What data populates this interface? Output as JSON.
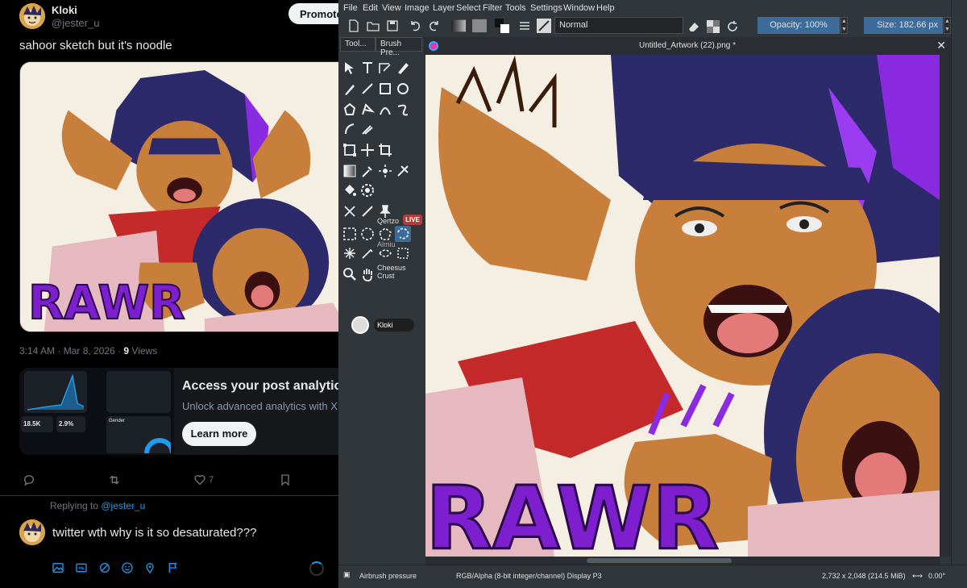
{
  "twitter": {
    "author": {
      "name": "Kloki",
      "handle": "@jester_u"
    },
    "promote_label": "Promote",
    "post_text": "sahoor sketch but it's noodle",
    "meta": {
      "time": "3:14 AM · Mar 8, 2026 · ",
      "views_count": "9",
      "views_label": " Views"
    },
    "analytics": {
      "title": "Access your post analytics",
      "subtitle": "Unlock advanced analytics with X P",
      "cta": "Learn more",
      "thumb_stats": [
        "18.5K",
        "2.9%"
      ],
      "thumb_label": "Gender"
    },
    "actions": {
      "likes": "7"
    },
    "reply": {
      "replying_prefix": "Replying to ",
      "replying_to": "@jester_u",
      "text": "twitter wth why is it so desaturated???"
    },
    "artwork_text": "RAWR"
  },
  "krita": {
    "menus": [
      "File",
      "Edit",
      "View",
      "Image",
      "Layer",
      "Select",
      "Filter",
      "Tools",
      "Settings",
      "Window",
      "Help"
    ],
    "blend_mode": "Normal",
    "opacity": "Opacity: 100%",
    "size": "Size: 182.66 px",
    "dock_tabs": [
      "Tool...",
      "Brush Pre..."
    ],
    "document_title": "Untitled_Artwork (22).png *",
    "collaborators": [
      "Qertzo",
      "Almiu",
      "Cheesus Crust",
      "Kloki"
    ],
    "live_badge": "LIVE",
    "status": {
      "brush": "Airbrush pressure",
      "color_info": "RGB/Alpha (8-bit integer/channel)  Display P3",
      "dimensions": "2,732 x 2,048 (214.5 MiB)",
      "rotation": "0.00°"
    },
    "accent_color": "#3d6c9a"
  }
}
